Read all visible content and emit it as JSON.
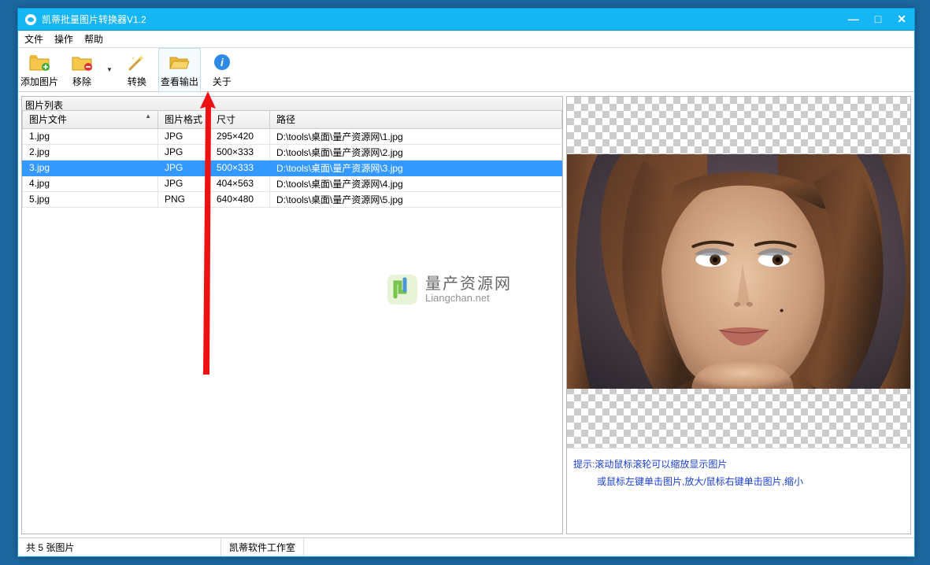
{
  "window": {
    "title": "凯蒂批量图片转换器V1.2"
  },
  "menu": {
    "file": "文件",
    "operation": "操作",
    "help": "帮助"
  },
  "toolbar": {
    "add": "添加图片",
    "remove": "移除",
    "convert": "转换",
    "view_output": "查看输出",
    "about": "关于"
  },
  "list": {
    "title": "图片列表",
    "columns": {
      "file": "图片文件",
      "format": "图片格式",
      "size": "尺寸",
      "path": "路径"
    },
    "rows": [
      {
        "file": "1.jpg",
        "format": "JPG",
        "size": "295×420",
        "path": "D:\\tools\\桌面\\量产资源网\\1.jpg",
        "selected": false
      },
      {
        "file": "2.jpg",
        "format": "JPG",
        "size": "500×333",
        "path": "D:\\tools\\桌面\\量产资源网\\2.jpg",
        "selected": false
      },
      {
        "file": "3.jpg",
        "format": "JPG",
        "size": "500×333",
        "path": "D:\\tools\\桌面\\量产资源网\\3.jpg",
        "selected": true
      },
      {
        "file": "4.jpg",
        "format": "JPG",
        "size": "404×563",
        "path": "D:\\tools\\桌面\\量产资源网\\4.jpg",
        "selected": false
      },
      {
        "file": "5.jpg",
        "format": "PNG",
        "size": "640×480",
        "path": "D:\\tools\\桌面\\量产资源网\\5.jpg",
        "selected": false
      }
    ]
  },
  "tips": {
    "line1": "提示:滚动鼠标滚轮可以缩放显示图片",
    "line2": "或鼠标左键单击图片,放大/鼠标右键单击图片,缩小"
  },
  "status": {
    "count": "共 5 张图片",
    "studio": "凯蒂软件工作室"
  },
  "watermark": {
    "cn": "量产资源网",
    "en": "Liangchan.net"
  }
}
